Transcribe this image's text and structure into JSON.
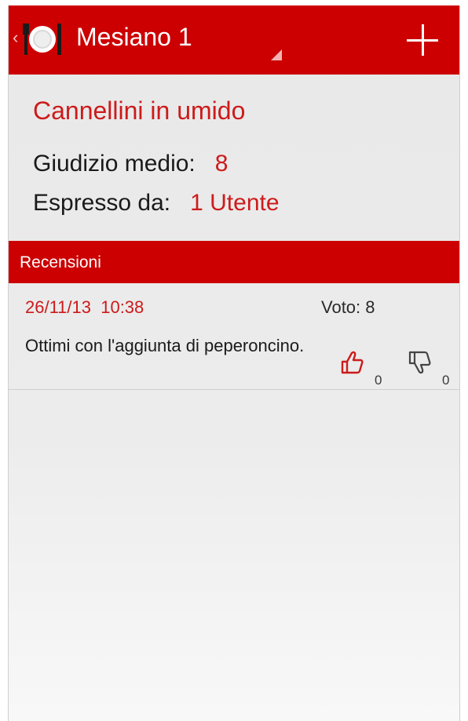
{
  "action_bar": {
    "title": "Mesiano 1",
    "up_caret": "‹",
    "app_icon": "plate-cutlery-icon",
    "add_icon": "plus-icon",
    "background_color": "#cc0000"
  },
  "dish": {
    "name": "Cannellini in umido",
    "avg_label": "Giudizio medio:",
    "avg_value": "8",
    "by_label": "Espresso da:",
    "by_value": "1 Utente"
  },
  "reviews_section": {
    "label": "Recensioni",
    "items": [
      {
        "date": "26/11/13  10:38",
        "vote": "Voto: 8",
        "text": "Ottimi con l'aggiunta di peperoncino.",
        "likes": "0",
        "dislikes": "0",
        "like_icon": "thumbs-up-icon",
        "dislike_icon": "thumbs-down-icon"
      }
    ]
  },
  "colors": {
    "accent": "#cc1b1b",
    "bar": "#cc0000"
  }
}
